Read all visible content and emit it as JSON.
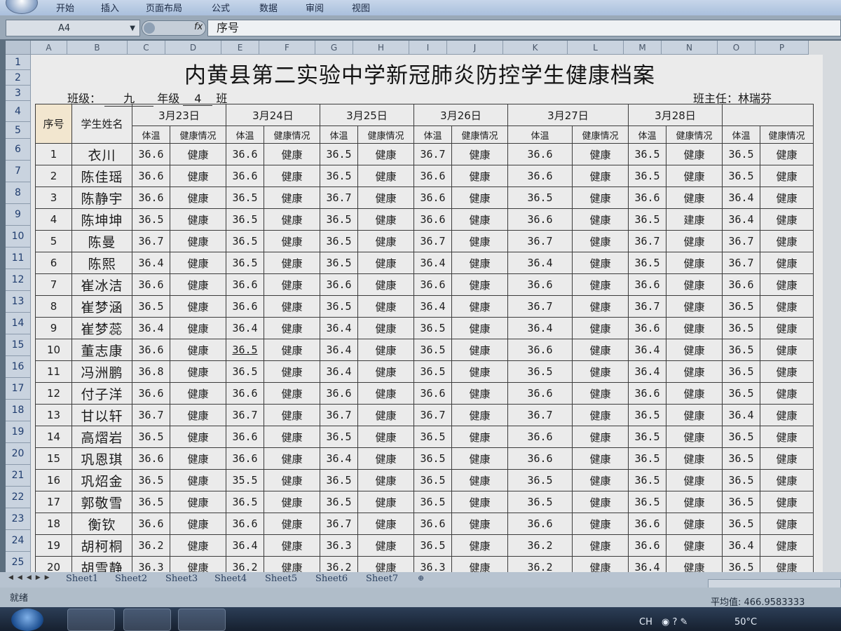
{
  "ribbon": {
    "tabs": [
      "开始",
      "插入",
      "页面布局",
      "公式",
      "数据",
      "审阅",
      "视图"
    ]
  },
  "formula_bar": {
    "cell_ref": "A4",
    "fx": "fx",
    "content": "序号"
  },
  "column_headers": [
    "A",
    "B",
    "C",
    "D",
    "E",
    "F",
    "G",
    "H",
    "I",
    "J",
    "K",
    "L",
    "M",
    "N",
    "O",
    "P"
  ],
  "row_headers": [
    "1",
    "2",
    "3",
    "4",
    "5",
    "6",
    "7",
    "8",
    "9",
    "10",
    "11",
    "12",
    "13",
    "14",
    "15",
    "16",
    "17",
    "18",
    "19",
    "20",
    "21",
    "22",
    "23",
    "24",
    "25"
  ],
  "sheet": {
    "title": "内黄县第二实验中学新冠肺炎防控学生健康档案",
    "class_label": "班级：",
    "grade_value": "九",
    "grade_label": "年级",
    "class_value": "4",
    "class_suffix": "班",
    "teacher": "班主任：林瑞芬",
    "col_no": "序号",
    "col_name": "学生姓名",
    "dates": [
      "3月23日",
      "3月24日",
      "3月25日",
      "3月26日",
      "3月27日",
      "3月28日",
      ""
    ],
    "sub_temp": "体温",
    "sub_health": "健康情况",
    "rows": [
      {
        "no": "1",
        "name": "衣川",
        "t": [
          "36.6",
          "36.6",
          "36.5",
          "36.7",
          "36.6",
          "36.5",
          "36.5"
        ],
        "h": [
          "健康",
          "健康",
          "健康",
          "健康",
          "健康",
          "健康",
          "健康"
        ]
      },
      {
        "no": "2",
        "name": "陈佳瑶",
        "t": [
          "36.6",
          "36.6",
          "36.5",
          "36.6",
          "36.6",
          "36.5",
          "36.5"
        ],
        "h": [
          "健康",
          "健康",
          "健康",
          "健康",
          "健康",
          "健康",
          "健康"
        ]
      },
      {
        "no": "3",
        "name": "陈静宇",
        "t": [
          "36.6",
          "36.5",
          "36.7",
          "36.6",
          "36.5",
          "36.6",
          "36.4"
        ],
        "h": [
          "健康",
          "健康",
          "健康",
          "健康",
          "健康",
          "健康",
          "健康"
        ]
      },
      {
        "no": "4",
        "name": "陈坤坤",
        "t": [
          "36.5",
          "36.5",
          "36.5",
          "36.6",
          "36.6",
          "36.5",
          "36.4"
        ],
        "h": [
          "健康",
          "健康",
          "健康",
          "健康",
          "健康",
          "建康",
          "健康"
        ]
      },
      {
        "no": "5",
        "name": "陈曼",
        "t": [
          "36.7",
          "36.5",
          "36.5",
          "36.7",
          "36.7",
          "36.7",
          "36.7"
        ],
        "h": [
          "健康",
          "健康",
          "健康",
          "健康",
          "健康",
          "健康",
          "健康"
        ]
      },
      {
        "no": "6",
        "name": "陈熙",
        "t": [
          "36.4",
          "36.5",
          "36.5",
          "36.4",
          "36.4",
          "36.5",
          "36.7"
        ],
        "h": [
          "健康",
          "健康",
          "健康",
          "健康",
          "健康",
          "健康",
          "健康"
        ]
      },
      {
        "no": "7",
        "name": "崔冰洁",
        "t": [
          "36.6",
          "36.6",
          "36.6",
          "36.6",
          "36.6",
          "36.6",
          "36.6"
        ],
        "h": [
          "健康",
          "健康",
          "健康",
          "健康",
          "健康",
          "健康",
          "健康"
        ]
      },
      {
        "no": "8",
        "name": "崔梦涵",
        "t": [
          "36.5",
          "36.6",
          "36.5",
          "36.4",
          "36.7",
          "36.7",
          "36.5"
        ],
        "h": [
          "健康",
          "健康",
          "健康",
          "健康",
          "健康",
          "健康",
          "健康"
        ]
      },
      {
        "no": "9",
        "name": "崔梦蕊",
        "t": [
          "36.4",
          "36.4",
          "36.4",
          "36.5",
          "36.4",
          "36.6",
          "36.5"
        ],
        "h": [
          "健康",
          "健康",
          "健康",
          "健康",
          "健康",
          "健康",
          "健康"
        ]
      },
      {
        "no": "10",
        "name": "董志康",
        "t": [
          "36.6",
          "36.5",
          "36.4",
          "36.5",
          "36.6",
          "36.4",
          "36.5"
        ],
        "h": [
          "健康",
          "健康",
          "健康",
          "健康",
          "健康",
          "健康",
          "健康"
        ]
      },
      {
        "no": "11",
        "name": "冯洲鹏",
        "t": [
          "36.8",
          "36.5",
          "36.4",
          "36.5",
          "36.5",
          "36.4",
          "36.5"
        ],
        "h": [
          "健康",
          "健康",
          "健康",
          "健康",
          "健康",
          "健康",
          "健康"
        ]
      },
      {
        "no": "12",
        "name": "付子洋",
        "t": [
          "36.6",
          "36.6",
          "36.6",
          "36.6",
          "36.6",
          "36.6",
          "36.5"
        ],
        "h": [
          "健康",
          "健康",
          "健康",
          "健康",
          "健康",
          "健康",
          "健康"
        ]
      },
      {
        "no": "13",
        "name": "甘以轩",
        "t": [
          "36.7",
          "36.7",
          "36.7",
          "36.7",
          "36.7",
          "36.5",
          "36.4"
        ],
        "h": [
          "健康",
          "健康",
          "健康",
          "健康",
          "健康",
          "健康",
          "健康"
        ]
      },
      {
        "no": "14",
        "name": "高熠岩",
        "t": [
          "36.5",
          "36.6",
          "36.5",
          "36.5",
          "36.6",
          "36.5",
          "36.5"
        ],
        "h": [
          "健康",
          "健康",
          "健康",
          "健康",
          "健康",
          "健康",
          "健康"
        ]
      },
      {
        "no": "15",
        "name": "巩恩琪",
        "t": [
          "36.6",
          "36.6",
          "36.4",
          "36.5",
          "36.6",
          "36.5",
          "36.5"
        ],
        "h": [
          "健康",
          "健康",
          "健康",
          "健康",
          "健康",
          "健康",
          "健康"
        ]
      },
      {
        "no": "16",
        "name": "巩炤金",
        "t": [
          "36.5",
          "35.5",
          "36.5",
          "36.5",
          "36.5",
          "36.5",
          "36.5"
        ],
        "h": [
          "健康",
          "健康",
          "健康",
          "健康",
          "健康",
          "健康",
          "健康"
        ]
      },
      {
        "no": "17",
        "name": "郭敬雪",
        "t": [
          "36.5",
          "36.5",
          "36.5",
          "36.5",
          "36.5",
          "36.5",
          "36.5"
        ],
        "h": [
          "健康",
          "健康",
          "健康",
          "健康",
          "健康",
          "健康",
          "健康"
        ]
      },
      {
        "no": "18",
        "name": "衡钦",
        "t": [
          "36.6",
          "36.6",
          "36.7",
          "36.6",
          "36.6",
          "36.6",
          "36.5"
        ],
        "h": [
          "健康",
          "健康",
          "健康",
          "健康",
          "健康",
          "健康",
          "健康"
        ]
      },
      {
        "no": "19",
        "name": "胡柯桐",
        "t": [
          "36.2",
          "36.4",
          "36.3",
          "36.5",
          "36.2",
          "36.6",
          "36.4"
        ],
        "h": [
          "健康",
          "健康",
          "健康",
          "健康",
          "健康",
          "健康",
          "健康"
        ]
      },
      {
        "no": "20",
        "name": "胡雪静",
        "t": [
          "36.3",
          "36.2",
          "36.2",
          "36.3",
          "36.2",
          "36.4",
          "36.5"
        ],
        "h": [
          "健康",
          "健康",
          "健康",
          "健康",
          "健康",
          "健康",
          "健康"
        ]
      }
    ]
  },
  "sheet_tabs": [
    "Sheet1",
    "Sheet2",
    "Sheet3",
    "Sheet4",
    "Sheet5",
    "Sheet6",
    "Sheet7"
  ],
  "status": {
    "ready": "就绪",
    "average": "平均值: 466.9583333"
  },
  "tray": {
    "lang": "CH",
    "temp": "50°C"
  }
}
